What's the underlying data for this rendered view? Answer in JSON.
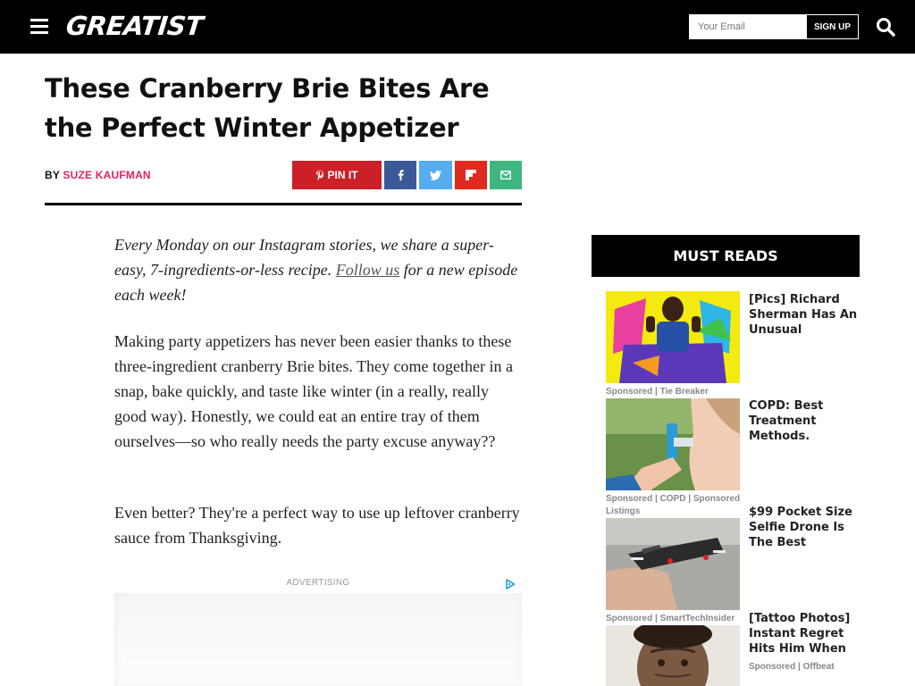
{
  "header": {
    "logo": "GREATIST",
    "email_placeholder": "Your Email",
    "signup_label": "SIGN UP"
  },
  "article": {
    "title": "These Cranberry Brie Bites Are the Perfect Winter Appetizer",
    "by_label": "BY",
    "author": "SUZE KAUFMAN",
    "pin_label": "PIN IT",
    "intro_before_link": "Every Monday on our Instagram stories, we share a super-easy, 7-ingredients-or-less recipe. ",
    "intro_link": "Follow us",
    "intro_after_link": " for a new episode each week!",
    "paragraph_1": "Making party appetizers has never been easier thanks to these three-ingredient cranberry Brie bites. They come together in a snap, bake quickly, and taste like winter (in a really, really good way). Honestly, we could eat an entire tray of them ourselves—so who really needs the party excuse anyway??",
    "paragraph_2": "Even better? They're a perfect way to use up leftover cranberry sauce from Thanksgiving.",
    "ad_label": "ADVERTISING"
  },
  "sidebar": {
    "heading": "MUST READS",
    "cards": [
      {
        "title": "[Pics] Richard Sherman Has An Unusual",
        "sponsor": "Sponsored | Tie Breaker"
      },
      {
        "title": "COPD: Best Treatment Methods.",
        "sponsor": "Sponsored | COPD | Sponsored Listings"
      },
      {
        "title": "$99 Pocket Size Selfie Drone Is The Best",
        "sponsor": "Sponsored | SmartTechInsider"
      },
      {
        "title": "[Tattoo Photos] Instant Regret Hits Him When",
        "sponsor": "Sponsored | Offbeat"
      }
    ]
  },
  "colors": {
    "header_bg": "#000000",
    "author_link": "#e0245e",
    "pinterest": "#cb2027",
    "facebook": "#3b5998",
    "twitter": "#55acee",
    "flipboard": "#e02a20",
    "email_share": "#3fb67f"
  },
  "icons": [
    "menu-icon",
    "search-icon",
    "pinterest-icon",
    "facebook-icon",
    "twitter-icon",
    "flipboard-icon",
    "email-icon",
    "adchoices-icon"
  ]
}
